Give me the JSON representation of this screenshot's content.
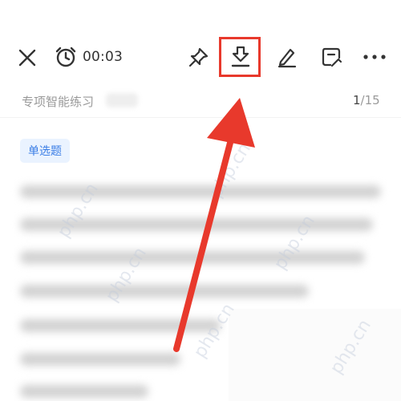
{
  "toolbar": {
    "timer": "00:03",
    "icons": [
      "close-icon",
      "alarm-clock-icon",
      "pin-icon",
      "download-icon",
      "pen-icon",
      "note-icon",
      "more-icon"
    ]
  },
  "subheader": {
    "title": "专项智能练习",
    "progress_current": "1",
    "progress_total": "/15"
  },
  "question": {
    "type_tag": "单选题"
  },
  "watermark": "php.cn",
  "colors": {
    "accent_red": "#e8392c",
    "tag_blue": "#3b7ee6",
    "tag_bg": "#eaf3ff"
  }
}
